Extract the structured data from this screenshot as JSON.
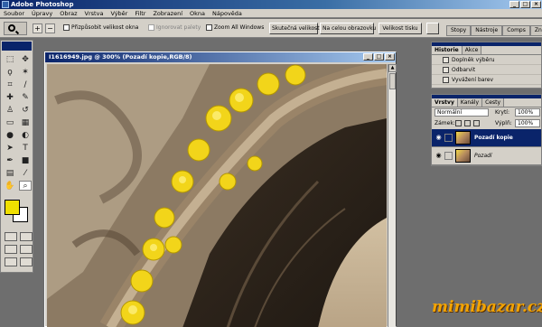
{
  "app": {
    "title": "Adobe Photoshop"
  },
  "window_buttons": [
    "_",
    "□",
    "×"
  ],
  "menu": [
    "Soubor",
    "Úpravy",
    "Obraz",
    "Vrstva",
    "Výběr",
    "Filtr",
    "Zobrazení",
    "Okna",
    "Nápověda"
  ],
  "options": {
    "resize_windows": "Přizpůsobit velikost okna",
    "ignore_palettes": "Ignorovat palety",
    "zoom_all": "Zoom All Windows",
    "actual_size": "Skutečná velikost",
    "fit_screen": "Na celou obrazovku",
    "print_size": "Velikost tisku"
  },
  "palette_well": [
    "Stopy",
    "Nástroje",
    "Comps",
    "Znaky"
  ],
  "document": {
    "title": "I1616949.jpg @ 300% (Pozadí kopie,RGB/8)"
  },
  "colors": {
    "foreground": "#f0df00",
    "background": "#ffffff"
  },
  "history": {
    "tabs": [
      "Historie",
      "Akce"
    ],
    "items": [
      "Doplněk výběru",
      "Odbarvit",
      "Vyvážení barev"
    ]
  },
  "layers": {
    "tabs": [
      "Vrstvy",
      "Kanály",
      "Cesty"
    ],
    "blend_mode": "Normální",
    "opacity_label": "Krytí:",
    "opacity_value": "100%",
    "lock_label": "Zámek:",
    "fill_label": "Výplň:",
    "fill_value": "100%",
    "items": [
      {
        "name": "Pozadí kopie",
        "selected": true
      },
      {
        "name": "Pozadí",
        "selected": false
      }
    ]
  },
  "watermark": "mimibazar.cz"
}
